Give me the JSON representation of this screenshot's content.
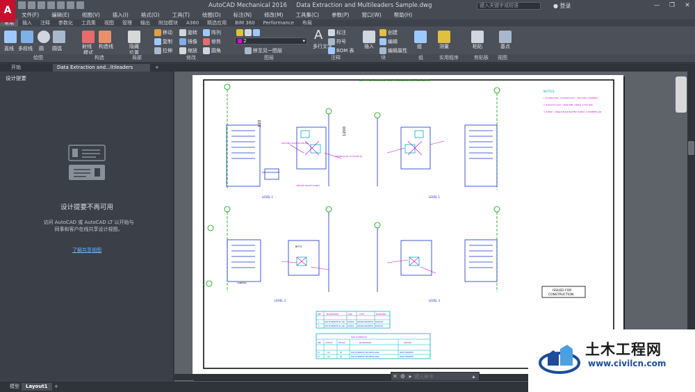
{
  "titlebar": {
    "app_name": "AutoCAD Mechanical 2016",
    "file_name": "Data Extraction and Multileaders Sample.dwg",
    "search_placeholder": "键入关键字或短语",
    "login": "登录",
    "logo": "A"
  },
  "menu": [
    "文件(F)",
    "编辑(E)",
    "视图(V)",
    "插入(I)",
    "格式(O)",
    "工具(T)",
    "绘图(D)",
    "标注(N)",
    "修改(M)",
    "工具集(C)",
    "参数(P)",
    "窗口(W)",
    "帮助(H)"
  ],
  "ribbon_tabs": [
    "常用",
    "插入",
    "注释",
    "参数化",
    "工具集",
    "视图",
    "管理",
    "输出",
    "附加模块",
    "A360",
    "精选应用",
    "BIM 360",
    "Performance",
    "布局"
  ],
  "ribbon_active_tab": "常用",
  "ribbon": {
    "draw": [
      "直线",
      "多段线",
      "圆",
      "圆弧"
    ],
    "construct": [
      "射线",
      "构造线",
      "模式"
    ],
    "detail": [
      "隐藏",
      "位置"
    ],
    "modify": [
      "移动",
      "旋转",
      "修剪",
      "复制",
      "镜像",
      "圆角",
      "拉伸",
      "缩放",
      "阵列"
    ],
    "layer": {
      "current": "2",
      "match": "移至另一图层"
    },
    "annotation": [
      "多行文字",
      "标注",
      "符号",
      "BOM 表"
    ],
    "block": [
      "插入",
      "创建",
      "编辑",
      "编辑属性"
    ],
    "group": [
      "组"
    ],
    "utilities": [
      "测量"
    ],
    "clipboard": [
      "粘贴"
    ],
    "view": [
      "基点"
    ]
  },
  "ribbon_panels": [
    "绘图",
    "构造",
    "局部",
    "修改",
    "图层",
    "注释",
    "块",
    "组",
    "实用程序",
    "剪贴板",
    "视图"
  ],
  "doc_tabs": [
    "开始",
    "Data Extraction and...ltileaders Sample*"
  ],
  "left_panel": {
    "title": "设计提要",
    "heading": "设计提要不再可用",
    "body": "访问 AutoCAD 或 AutoCAD LT 以开始与同事和客户在线共享设计视图。",
    "link": "了解共享视图"
  },
  "drawing": {
    "header_note": "ALL TO BE ORIENTED PLAN TO ALIGN DETAIL / SEE ABOVE",
    "dimensions": [
      "120",
      "1200"
    ],
    "notes_title": "NOTES:",
    "notes": [
      "1. EXTRACTION - FLEXIBLE DUCT - POLYVINYL SPLENDID",
      "2. EXHAUST DUCT - IRON PIPE - SPIRAL 1 FOR (EN)",
      "3. SUPPLY - SINGLE BLOW BATTERY SUPPLY 2 SUMMERS AIR"
    ],
    "stamp": [
      "ISSUED FOR",
      "CONSTRUCTION"
    ],
    "levels": [
      "LEVEL 1",
      "LEVEL 1",
      "LEVEL 3",
      "LEVEL 3"
    ],
    "labels": [
      "GROUND SLOT IN CEILING",
      "UNDER SLAT TO SLOPE IN",
      "BELOW GRATE SUPPLY",
      "BOT1",
      "LANDING"
    ],
    "table1": {
      "headers": [
        "REF",
        "MAKE/MODEL",
        "SIZE",
        "TYPE",
        "MOUNTING"
      ],
      "rows": [
        [
          "1",
          "FAN TO REMOTE IN, 300",
          "100X50",
          "CEILING MOUNTED",
          "EXHAUST"
        ],
        [
          "2",
          "FAN TO REMOTE IN, 300",
          "150X50",
          "CEILING MOUNTED",
          "EXHAUST"
        ]
      ]
    },
    "table2": {
      "title": "FAN SCHEDULE",
      "headers": [
        "REF",
        "OUTPUT",
        "MOTOR",
        "MAKE/MODEL",
        "SERVICE"
      ],
      "rows": [
        [
          "F1",
          "0.5",
          "45",
          "FAN TO REMOTE 300 MM IN AXIAL",
          "ROOF MOUNTED"
        ],
        [
          "F2",
          "0.5",
          "45",
          "FAN TO REMOTE 300 MM IN AXIAL",
          "ROOF MOUNTED"
        ]
      ]
    }
  },
  "cmdline": {
    "placeholder": "键入命令"
  },
  "layout_tabs": [
    "模型",
    "Layout1"
  ],
  "watermark": {
    "text": "土木工程网",
    "url": "www.civilcn.com"
  },
  "colors": {
    "accent": "#c8102e",
    "panel": "#3b4048",
    "drawing_blue": "#1030c8",
    "drawing_magenta": "#d000d0",
    "drawing_green": "#00a000",
    "drawing_cyan": "#00b0c0"
  }
}
